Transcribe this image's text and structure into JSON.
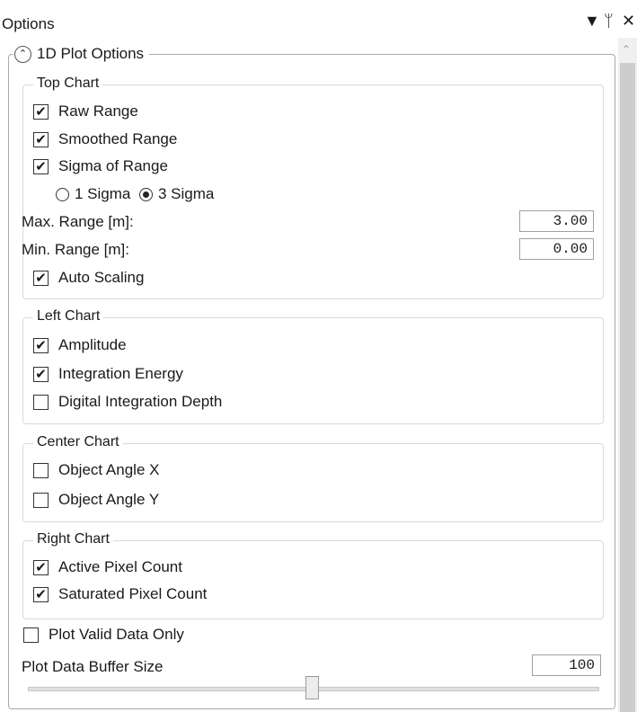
{
  "title": "Options",
  "controls": {
    "dropdown": "▼",
    "pin": "ᛘ",
    "close": "✕"
  },
  "panel_label": "1D Plot Options",
  "top_chart": {
    "label": "Top Chart",
    "raw_range": "Raw Range",
    "raw_range_checked": true,
    "smoothed_range": "Smoothed Range",
    "smoothed_range_checked": true,
    "sigma_of_range": "Sigma of Range",
    "sigma_of_range_checked": true,
    "sigma1": "1 Sigma",
    "sigma3": "3 Sigma",
    "sigma_selected": "3 Sigma",
    "max_range_label": "Max. Range [m]:",
    "max_range_value": "3.00",
    "min_range_label": "Min. Range [m]:",
    "min_range_value": "0.00",
    "auto_scaling": "Auto Scaling",
    "auto_scaling_checked": true
  },
  "left_chart": {
    "label": "Left Chart",
    "amplitude": "Amplitude",
    "amplitude_checked": true,
    "integration_energy": "Integration Energy",
    "integration_energy_checked": true,
    "digital_integration_depth": "Digital Integration Depth",
    "digital_integration_depth_checked": false
  },
  "center_chart": {
    "label": "Center Chart",
    "object_angle_x": "Object Angle X",
    "object_angle_x_checked": false,
    "object_angle_y": "Object Angle Y",
    "object_angle_y_checked": false
  },
  "right_chart": {
    "label": "Right Chart",
    "active_pixel_count": "Active Pixel Count",
    "active_pixel_count_checked": true,
    "saturated_pixel_count": "Saturated Pixel Count",
    "saturated_pixel_count_checked": true
  },
  "plot_valid_data_only": "Plot Valid Data Only",
  "plot_valid_data_only_checked": false,
  "buffer_size_label": "Plot Data Buffer Size",
  "buffer_size_value": "100",
  "buffer_slider_level": 0.5
}
